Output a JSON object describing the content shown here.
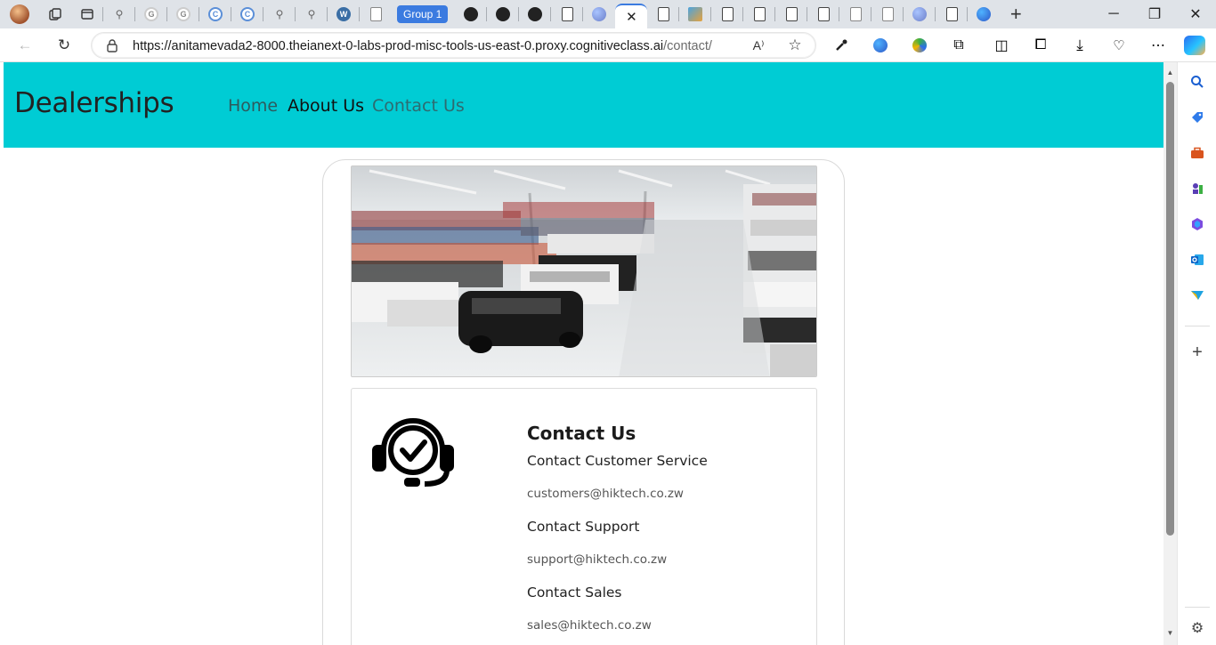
{
  "browser": {
    "group_label": "Group 1",
    "url_host": "https://anitamevada2-8000.theianext-0-labs-prod-misc-tools-us-east-0.proxy.cognitiveclass.ai",
    "url_path": "/contact/",
    "accent": "#3b7be0"
  },
  "page": {
    "brand": "Dealerships",
    "nav": {
      "home": "Home",
      "about": "About Us",
      "contact": "Contact Us"
    },
    "navbar_color": "#00ccd4",
    "contact": {
      "title": "Contact Us",
      "customer_service_label": "Contact Customer Service",
      "customer_service_email": "customers@hiktech.co.zw",
      "support_label": "Contact Support",
      "support_email": "support@hiktech.co.zw",
      "sales_label": "Contact Sales",
      "sales_email": "sales@hiktech.co.zw"
    }
  }
}
